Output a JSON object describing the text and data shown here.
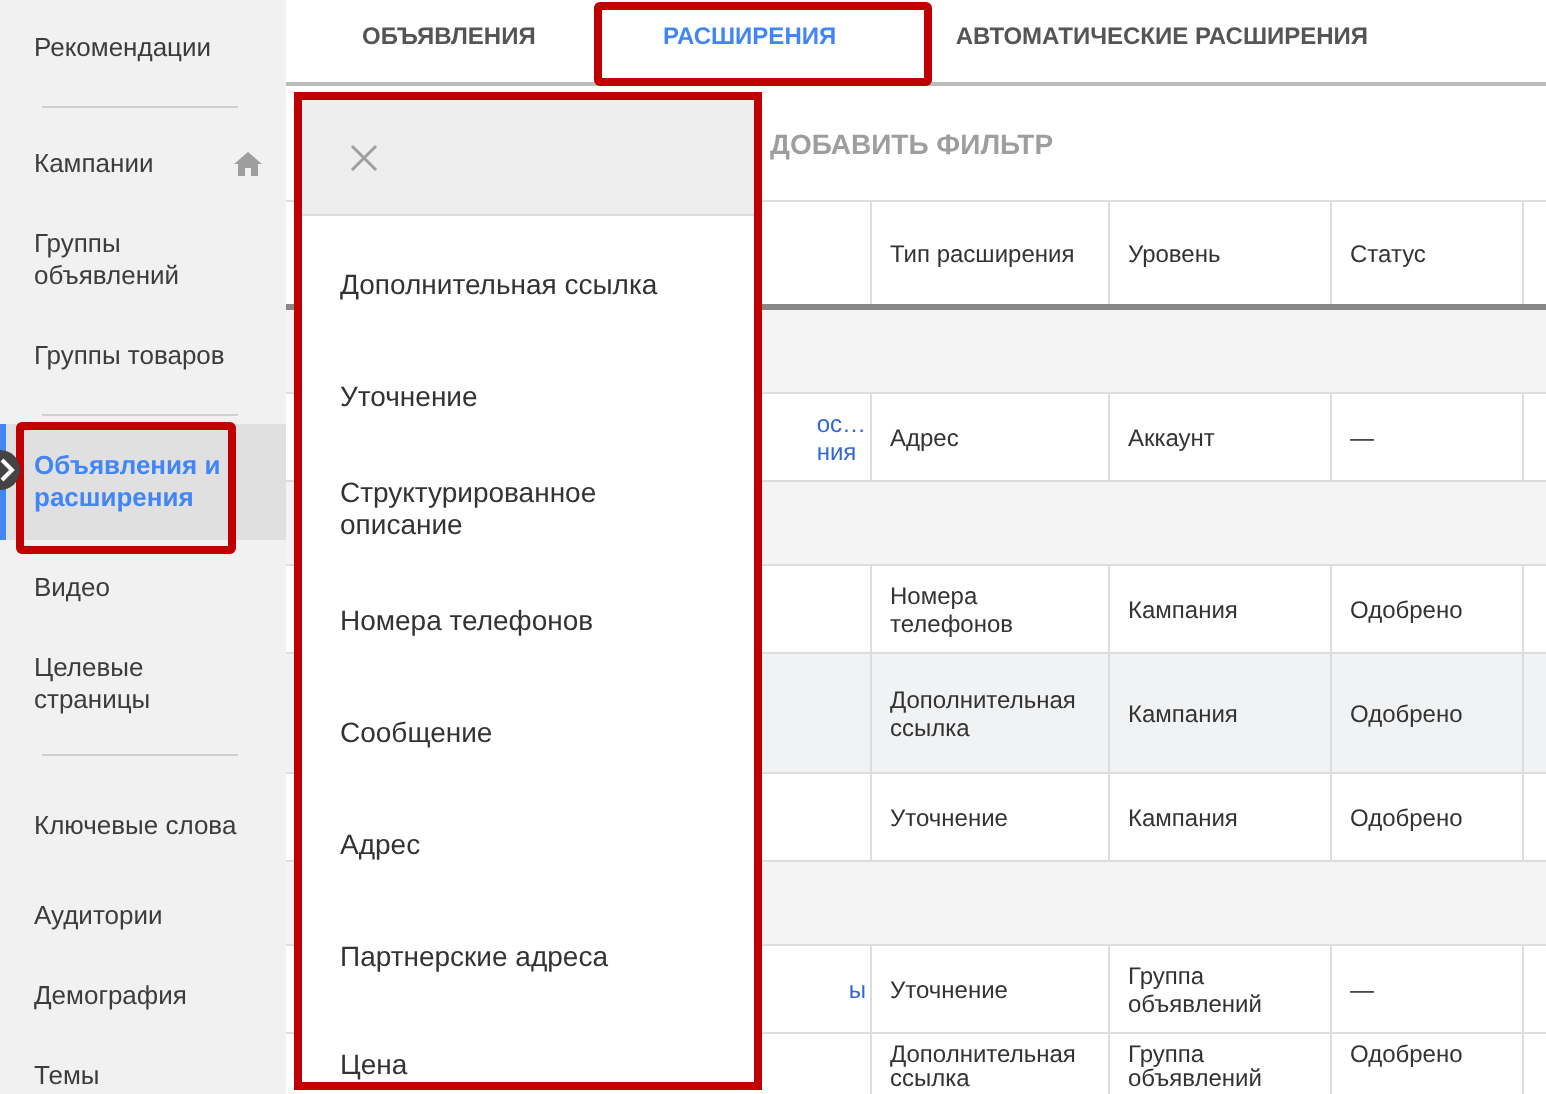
{
  "sidebar": {
    "sections": [
      [
        {
          "label": "Рекомендации",
          "selected": false
        }
      ],
      [
        {
          "label": "Кампании",
          "selected": false
        },
        {
          "label": "Группы объявлений",
          "selected": false
        },
        {
          "label": "Группы товаров",
          "selected": false
        }
      ],
      [
        {
          "label": "Объявления и расширения",
          "selected": true
        },
        {
          "label": "Видео",
          "selected": false
        },
        {
          "label": "Целевые страницы",
          "selected": false
        }
      ],
      [
        {
          "label": "Ключевые слова",
          "selected": false
        },
        {
          "label": "Аудитории",
          "selected": false
        },
        {
          "label": "Демография",
          "selected": false
        },
        {
          "label": "Темы",
          "selected": false
        }
      ]
    ]
  },
  "tabs": [
    {
      "label": "ОБЪЯВЛЕНИЯ",
      "selected": false
    },
    {
      "label": "РАСШИРЕНИЯ",
      "selected": true
    },
    {
      "label": "АВТОМАТИЧЕСКИЕ РАСШИРЕНИЯ",
      "selected": false
    }
  ],
  "filter": {
    "label": "ДОБАВИТЬ ФИЛЬТР"
  },
  "table": {
    "columns": [
      "Тип расширения",
      "Уровень",
      "Статус"
    ],
    "rows": [
      {
        "kind": "group"
      },
      {
        "kind": "data",
        "highlighted": false,
        "column_1": "ос…\nния",
        "cells": [
          "Адрес",
          "Аккаунт",
          "—"
        ]
      },
      {
        "kind": "group"
      },
      {
        "kind": "data",
        "highlighted": false,
        "cells": [
          "Номера телефонов",
          "Кампания",
          "Одобрено"
        ]
      },
      {
        "kind": "data",
        "highlighted": true,
        "cells": [
          "Дополнительная ссылка",
          "Кампания",
          "Одобрено"
        ]
      },
      {
        "kind": "data",
        "highlighted": false,
        "cells": [
          "Уточнение",
          "Кампания",
          "Одобрено"
        ]
      },
      {
        "kind": "group"
      },
      {
        "kind": "data",
        "highlighted": false,
        "column_1": "ы",
        "cells": [
          "Уточнение",
          "Группа объявлений",
          "—"
        ]
      },
      {
        "kind": "data",
        "highlighted": false,
        "cells": [
          "Дополнительная ссылка",
          "Группа объявлений",
          "Одобрено"
        ]
      }
    ]
  },
  "dropdown": {
    "items": [
      "Дополнительная ссылка",
      "Уточнение",
      "Структурированное описание",
      "Номера телефонов",
      "Сообщение",
      "Адрес",
      "Партнерские адреса",
      "Цена"
    ]
  }
}
